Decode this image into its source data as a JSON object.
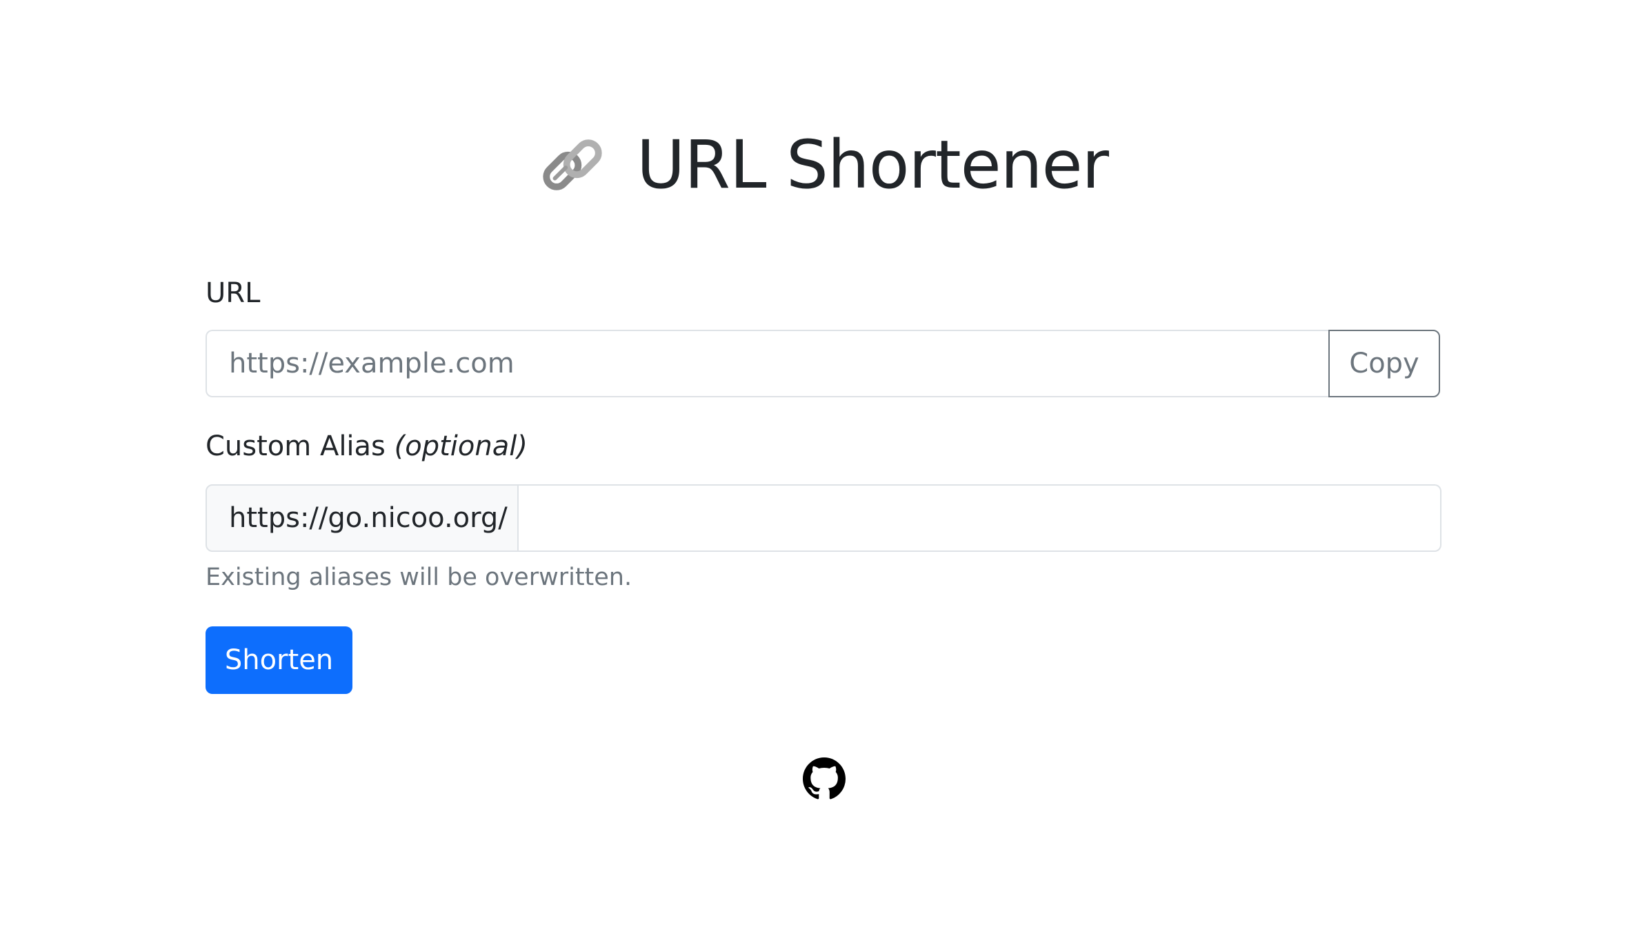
{
  "header": {
    "title": "URL Shortener",
    "icon": "link-chain-icon"
  },
  "form": {
    "url": {
      "label": "URL",
      "placeholder": "https://example.com",
      "value": "",
      "copy_label": "Copy"
    },
    "alias": {
      "label": "Custom Alias",
      "label_optional": "(optional)",
      "prefix": "https://go.nicoo.org/",
      "value": "",
      "help_text": "Existing aliases will be overwritten."
    },
    "submit_label": "Shorten"
  },
  "footer": {
    "icon": "github-icon"
  },
  "colors": {
    "primary": "#0d6efd",
    "text": "#212529",
    "muted": "#6c757d",
    "border": "#dee2e6",
    "prefix_bg": "#f8f9fa"
  }
}
